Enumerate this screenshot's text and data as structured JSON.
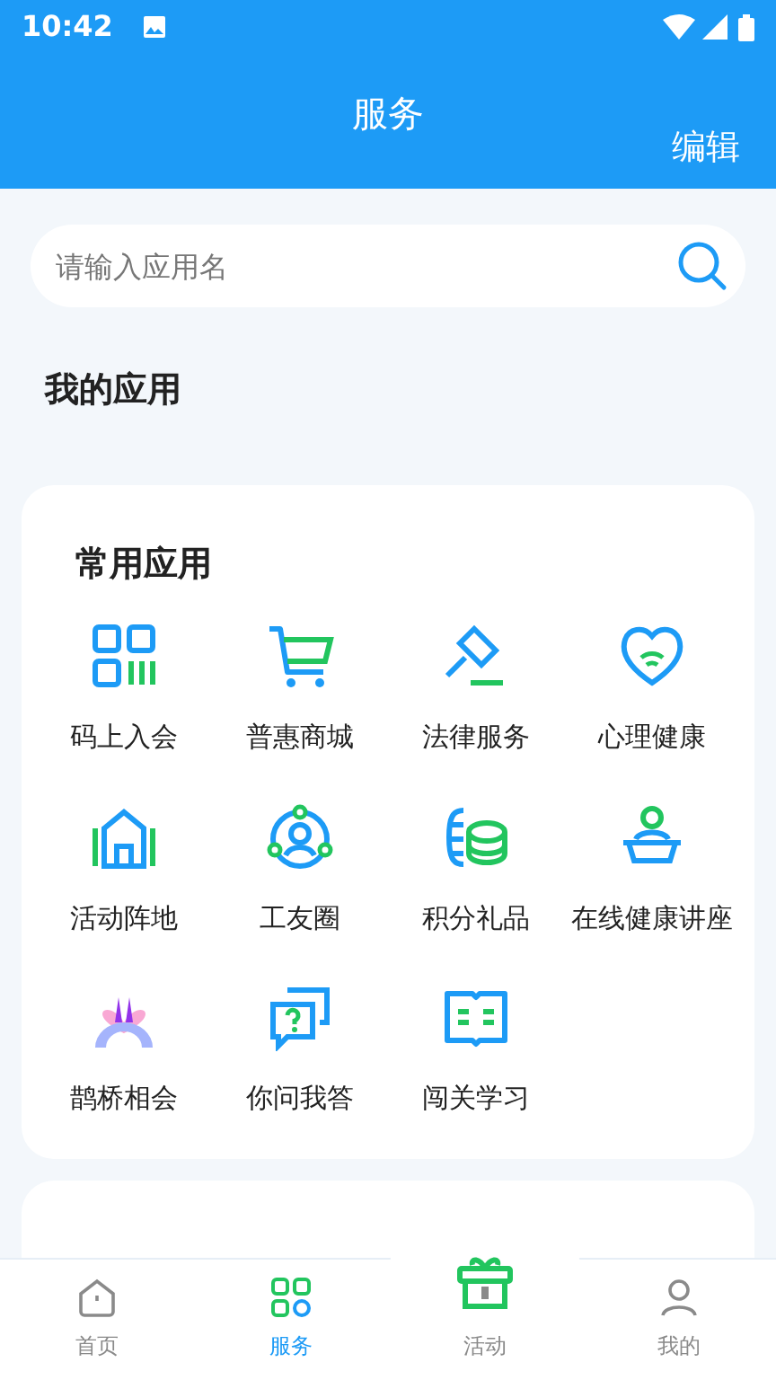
{
  "status_bar": {
    "time": "10:42"
  },
  "header": {
    "title": "服务",
    "action": "编辑"
  },
  "search": {
    "placeholder": "请输入应用名"
  },
  "section_title": "我的应用",
  "card": {
    "title": "常用应用",
    "apps": [
      {
        "label": "码上入会",
        "kind": "qr"
      },
      {
        "label": "普惠商城",
        "kind": "cart"
      },
      {
        "label": "法律服务",
        "kind": "gavel"
      },
      {
        "label": "心理健康",
        "kind": "heart"
      },
      {
        "label": "活动阵地",
        "kind": "house"
      },
      {
        "label": "工友圈",
        "kind": "circle"
      },
      {
        "label": "积分礼品",
        "kind": "coins"
      },
      {
        "label": "在线健康讲座",
        "kind": "lecture"
      },
      {
        "label": "鹊桥相会",
        "kind": "bridge"
      },
      {
        "label": "你问我答",
        "kind": "qa"
      },
      {
        "label": "闯关学习",
        "kind": "book"
      }
    ]
  },
  "tabs": [
    {
      "label": "首页",
      "kind": "home",
      "selected": false
    },
    {
      "label": "服务",
      "kind": "grid",
      "selected": true
    },
    {
      "label": "活动",
      "kind": "gift",
      "selected": false
    },
    {
      "label": "我的",
      "kind": "user",
      "selected": false
    }
  ]
}
